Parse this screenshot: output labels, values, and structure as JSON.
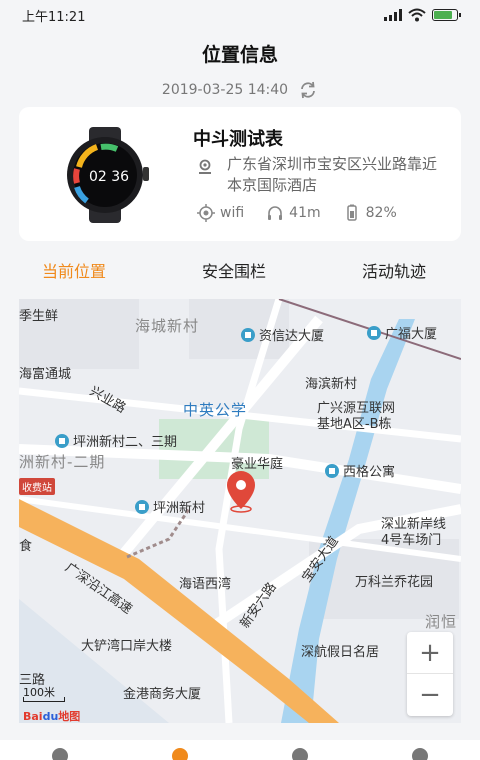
{
  "status_bar": {
    "time": "上午11:21",
    "battery_level": 0.8,
    "battery_color": "#4caf50"
  },
  "header": {
    "title": "位置信息",
    "timestamp": "2019-03-25 14:40"
  },
  "device": {
    "name": "中斗测试表",
    "address": "广东省深圳市宝安区兴业路靠近本京国际酒店",
    "network": "wifi",
    "accuracy": "41m",
    "battery": "82%",
    "watch_time": "02 36"
  },
  "tabs": [
    {
      "label": "当前位置",
      "active": true
    },
    {
      "label": "安全围栏",
      "active": false
    },
    {
      "label": "活动轨迹",
      "active": false
    }
  ],
  "map": {
    "labels": {
      "l1": "季生鲜",
      "l2": "海城新村",
      "l3": "资信达大厦",
      "l4": "广福大厦",
      "l5": "海富通城",
      "l6": "海滨新村",
      "l7": "兴业路",
      "l8": "中英公学",
      "l9": "广兴源互联网",
      "l10": "基地A区-B栋",
      "l11": "坪洲新村二、三期",
      "l12": "洲新村-二期",
      "l13": "豪业华庭",
      "l14": "西格公寓",
      "l15": "坪洲新村",
      "l16": "深业新岸线",
      "l17": "4号车场门",
      "l18": "广深沿江高速",
      "l19": "宝安大道",
      "l20": "新安六路",
      "l21": "海语西湾",
      "l22": "万科兰乔花园",
      "l23": "润恒",
      "l24": "大铲湾口岸大楼",
      "l25": "深航假日名居",
      "l26": "金港商务大厦",
      "l27": "食",
      "l28": "三路"
    },
    "toll": "收费站",
    "scale": "100米",
    "logo": "Bai",
    "logo2": "du",
    "logo3": "地图",
    "zoom_in": "+",
    "zoom_out": "−"
  },
  "colors": {
    "accent": "#f08a1c",
    "water": "#a9d4f0",
    "green_area": "#cfe8d5",
    "expressway": "#f6b25c"
  }
}
